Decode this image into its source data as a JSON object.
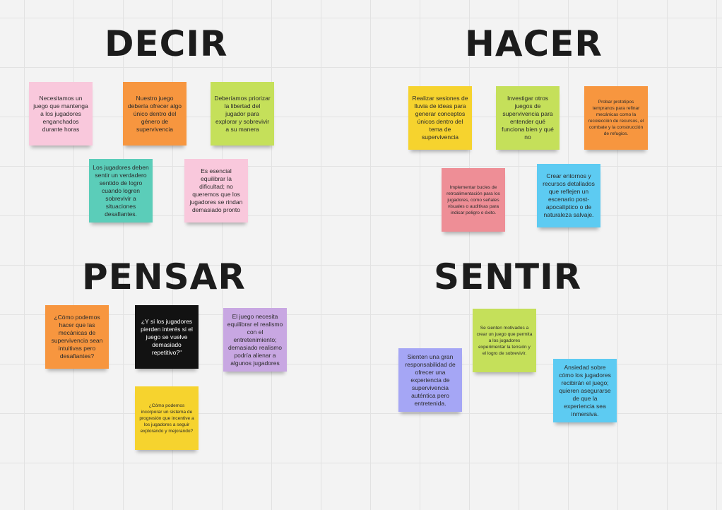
{
  "board": {
    "sections": [
      {
        "title": "DECIR"
      },
      {
        "title": "HACER"
      },
      {
        "title": "PENSAR"
      },
      {
        "title": "SENTIR"
      }
    ],
    "notes": {
      "decir": [
        {
          "text": "Necesitamos un juego que mantenga a los jugadores enganchados durante horas",
          "color": "#f9c8dc"
        },
        {
          "text": "Nuestro juego debería ofrecer algo único dentro del género de supervivencia",
          "color": "#f7963f"
        },
        {
          "text": "Deberíamos priorizar la libertad del jugador para explorar y sobrevivir a su manera",
          "color": "#c5e05a"
        },
        {
          "text": "Los jugadores deben sentir un verdadero sentido de logro cuando logren sobrevivir a situaciones desafiantes.",
          "color": "#5bcdb9"
        },
        {
          "text": "Es esencial equilibrar la dificultad; no queremos que los jugadores se rindan demasiado pronto",
          "color": "#f9c8dc"
        }
      ],
      "hacer": [
        {
          "text": "Realizar sesiones de lluvia de ideas para generar conceptos únicos dentro del tema de supervivencia",
          "color": "#f6d32e"
        },
        {
          "text": "Investigar otros juegos de supervivencia para entender qué funciona bien y qué no",
          "color": "#c5e05a"
        },
        {
          "text": "Probar prototipos tempranos para refinar mecánicas como la recolección de recursos, el combate y la construcción de refugios.",
          "color": "#f7963f"
        },
        {
          "text": "Implementar bucles de retroalimentación para los jugadores, como señales visuales o auditivas para indicar peligro o éxito.",
          "color": "#ee8e96"
        },
        {
          "text": "Crear entornos y recursos detallados que reflejen un escenario post-apocalíptico o de naturaleza salvaje.",
          "color": "#5dcbf2"
        }
      ],
      "pensar": [
        {
          "text": "¿Cómo podemos hacer que las mecánicas de supervivencia sean intuitivas pero desafiantes?",
          "color": "#f7963f"
        },
        {
          "text": "¿Y si los jugadores pierden interés si el juego se vuelve demasiado repetitivo?\"",
          "color": "#121212"
        },
        {
          "text": "El juego necesita equilibrar el realismo con el entretenimiento; demasiado realismo podría alienar a algunos jugadores",
          "color": "#c8a7e2"
        },
        {
          "text": "¿Cómo podemos incorporar un sistema de progresión que incentive a los jugadores a seguir explorando y mejorando?",
          "color": "#f6d32e"
        }
      ],
      "sentir": [
        {
          "text": "Se sienten motivados a crear un juego que permita a los jugadores experimentar la tensión y el logro de sobrevivir.",
          "color": "#c5e05a"
        },
        {
          "text": "Sienten una gran responsabilidad de ofrecer una experiencia de supervivencia auténtica pero entretenida.",
          "color": "#a5a6f5"
        },
        {
          "text": "Ansiedad sobre cómo los jugadores recibirán el juego; quieren asegurarse de que la experiencia sea inmersiva.",
          "color": "#5dcbf2"
        }
      ]
    }
  }
}
